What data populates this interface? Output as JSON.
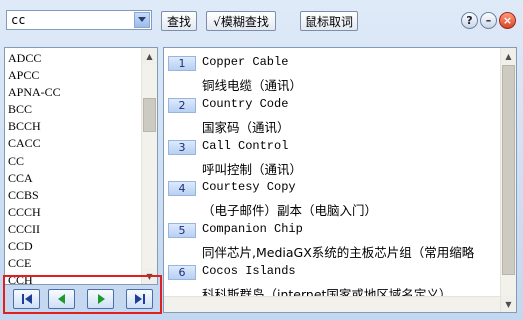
{
  "toolbar": {
    "search_value": "cc",
    "search_button": "查找",
    "fuzzy_search_button": "√模糊查找",
    "mouse_lookup_button": "鼠标取词",
    "help_label": "?",
    "minimize_label": "–",
    "close_label": "×"
  },
  "word_list": [
    "ADCC",
    "APCC",
    "APNA-CC",
    "BCC",
    "BCCH",
    "CACC",
    "CC",
    "CCA",
    "CCBS",
    "CCCH",
    "CCCII",
    "CCD",
    "CCE",
    "CCH"
  ],
  "entries": [
    {
      "num": "1",
      "term": "Copper Cable",
      "meaning": "铜线电缆（通讯）"
    },
    {
      "num": "2",
      "term": "Country Code",
      "meaning": "国家码（通讯）"
    },
    {
      "num": "3",
      "term": "Call Control",
      "meaning": "呼叫控制（通讯）"
    },
    {
      "num": "4",
      "term": "Courtesy Copy",
      "meaning": "（电子邮件）副本（电脑入门）"
    },
    {
      "num": "5",
      "term": "Companion Chip",
      "meaning": "同伴芯片,MediaGX系统的主板芯片组（常用缩略"
    },
    {
      "num": "6",
      "term": "Cocos Islands",
      "meaning": "科科斯群岛（internet国家或地区域名定义）"
    }
  ],
  "nav": {
    "first_icon": "first-page-icon",
    "prev_icon": "previous-page-icon",
    "next_icon": "next-page-icon",
    "last_icon": "last-page-icon"
  },
  "colors": {
    "highlight_border": "#e02020",
    "nav_arrow": "#1e9a2a",
    "nav_end_arrow": "#1f3e9a"
  }
}
